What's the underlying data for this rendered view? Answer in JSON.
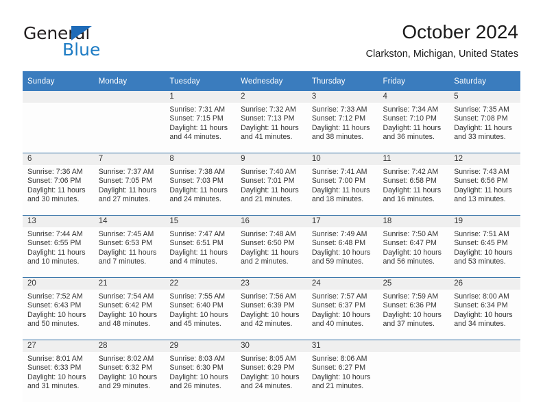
{
  "brand": {
    "name_primary": "General",
    "name_secondary": "Blue",
    "accent_color": "#1e7cc4",
    "triangle_color": "#1e6bb8"
  },
  "header": {
    "title": "October 2024",
    "subtitle": "Clarkston, Michigan, United States"
  },
  "theme": {
    "header_band": "#3a7cbe",
    "daynum_band": "#efefef",
    "week_divider": "#2e6da4",
    "text": "#333333"
  },
  "calendar": {
    "weekday_headers": [
      "Sunday",
      "Monday",
      "Tuesday",
      "Wednesday",
      "Thursday",
      "Friday",
      "Saturday"
    ],
    "labels": {
      "sunrise_prefix": "Sunrise:",
      "sunset_prefix": "Sunset:",
      "daylight_prefix": "Daylight:"
    },
    "weeks": [
      [
        {
          "day": "",
          "sunrise": "",
          "sunset": "",
          "daylight": "",
          "empty": true
        },
        {
          "day": "",
          "sunrise": "",
          "sunset": "",
          "daylight": "",
          "empty": true
        },
        {
          "day": "1",
          "sunrise": "Sunrise: 7:31 AM",
          "sunset": "Sunset: 7:15 PM",
          "daylight": "Daylight: 11 hours and 44 minutes.",
          "empty": false
        },
        {
          "day": "2",
          "sunrise": "Sunrise: 7:32 AM",
          "sunset": "Sunset: 7:13 PM",
          "daylight": "Daylight: 11 hours and 41 minutes.",
          "empty": false
        },
        {
          "day": "3",
          "sunrise": "Sunrise: 7:33 AM",
          "sunset": "Sunset: 7:12 PM",
          "daylight": "Daylight: 11 hours and 38 minutes.",
          "empty": false
        },
        {
          "day": "4",
          "sunrise": "Sunrise: 7:34 AM",
          "sunset": "Sunset: 7:10 PM",
          "daylight": "Daylight: 11 hours and 36 minutes.",
          "empty": false
        },
        {
          "day": "5",
          "sunrise": "Sunrise: 7:35 AM",
          "sunset": "Sunset: 7:08 PM",
          "daylight": "Daylight: 11 hours and 33 minutes.",
          "empty": false
        }
      ],
      [
        {
          "day": "6",
          "sunrise": "Sunrise: 7:36 AM",
          "sunset": "Sunset: 7:06 PM",
          "daylight": "Daylight: 11 hours and 30 minutes.",
          "empty": false
        },
        {
          "day": "7",
          "sunrise": "Sunrise: 7:37 AM",
          "sunset": "Sunset: 7:05 PM",
          "daylight": "Daylight: 11 hours and 27 minutes.",
          "empty": false
        },
        {
          "day": "8",
          "sunrise": "Sunrise: 7:38 AM",
          "sunset": "Sunset: 7:03 PM",
          "daylight": "Daylight: 11 hours and 24 minutes.",
          "empty": false
        },
        {
          "day": "9",
          "sunrise": "Sunrise: 7:40 AM",
          "sunset": "Sunset: 7:01 PM",
          "daylight": "Daylight: 11 hours and 21 minutes.",
          "empty": false
        },
        {
          "day": "10",
          "sunrise": "Sunrise: 7:41 AM",
          "sunset": "Sunset: 7:00 PM",
          "daylight": "Daylight: 11 hours and 18 minutes.",
          "empty": false
        },
        {
          "day": "11",
          "sunrise": "Sunrise: 7:42 AM",
          "sunset": "Sunset: 6:58 PM",
          "daylight": "Daylight: 11 hours and 16 minutes.",
          "empty": false
        },
        {
          "day": "12",
          "sunrise": "Sunrise: 7:43 AM",
          "sunset": "Sunset: 6:56 PM",
          "daylight": "Daylight: 11 hours and 13 minutes.",
          "empty": false
        }
      ],
      [
        {
          "day": "13",
          "sunrise": "Sunrise: 7:44 AM",
          "sunset": "Sunset: 6:55 PM",
          "daylight": "Daylight: 11 hours and 10 minutes.",
          "empty": false
        },
        {
          "day": "14",
          "sunrise": "Sunrise: 7:45 AM",
          "sunset": "Sunset: 6:53 PM",
          "daylight": "Daylight: 11 hours and 7 minutes.",
          "empty": false
        },
        {
          "day": "15",
          "sunrise": "Sunrise: 7:47 AM",
          "sunset": "Sunset: 6:51 PM",
          "daylight": "Daylight: 11 hours and 4 minutes.",
          "empty": false
        },
        {
          "day": "16",
          "sunrise": "Sunrise: 7:48 AM",
          "sunset": "Sunset: 6:50 PM",
          "daylight": "Daylight: 11 hours and 2 minutes.",
          "empty": false
        },
        {
          "day": "17",
          "sunrise": "Sunrise: 7:49 AM",
          "sunset": "Sunset: 6:48 PM",
          "daylight": "Daylight: 10 hours and 59 minutes.",
          "empty": false
        },
        {
          "day": "18",
          "sunrise": "Sunrise: 7:50 AM",
          "sunset": "Sunset: 6:47 PM",
          "daylight": "Daylight: 10 hours and 56 minutes.",
          "empty": false
        },
        {
          "day": "19",
          "sunrise": "Sunrise: 7:51 AM",
          "sunset": "Sunset: 6:45 PM",
          "daylight": "Daylight: 10 hours and 53 minutes.",
          "empty": false
        }
      ],
      [
        {
          "day": "20",
          "sunrise": "Sunrise: 7:52 AM",
          "sunset": "Sunset: 6:43 PM",
          "daylight": "Daylight: 10 hours and 50 minutes.",
          "empty": false
        },
        {
          "day": "21",
          "sunrise": "Sunrise: 7:54 AM",
          "sunset": "Sunset: 6:42 PM",
          "daylight": "Daylight: 10 hours and 48 minutes.",
          "empty": false
        },
        {
          "day": "22",
          "sunrise": "Sunrise: 7:55 AM",
          "sunset": "Sunset: 6:40 PM",
          "daylight": "Daylight: 10 hours and 45 minutes.",
          "empty": false
        },
        {
          "day": "23",
          "sunrise": "Sunrise: 7:56 AM",
          "sunset": "Sunset: 6:39 PM",
          "daylight": "Daylight: 10 hours and 42 minutes.",
          "empty": false
        },
        {
          "day": "24",
          "sunrise": "Sunrise: 7:57 AM",
          "sunset": "Sunset: 6:37 PM",
          "daylight": "Daylight: 10 hours and 40 minutes.",
          "empty": false
        },
        {
          "day": "25",
          "sunrise": "Sunrise: 7:59 AM",
          "sunset": "Sunset: 6:36 PM",
          "daylight": "Daylight: 10 hours and 37 minutes.",
          "empty": false
        },
        {
          "day": "26",
          "sunrise": "Sunrise: 8:00 AM",
          "sunset": "Sunset: 6:34 PM",
          "daylight": "Daylight: 10 hours and 34 minutes.",
          "empty": false
        }
      ],
      [
        {
          "day": "27",
          "sunrise": "Sunrise: 8:01 AM",
          "sunset": "Sunset: 6:33 PM",
          "daylight": "Daylight: 10 hours and 31 minutes.",
          "empty": false
        },
        {
          "day": "28",
          "sunrise": "Sunrise: 8:02 AM",
          "sunset": "Sunset: 6:32 PM",
          "daylight": "Daylight: 10 hours and 29 minutes.",
          "empty": false
        },
        {
          "day": "29",
          "sunrise": "Sunrise: 8:03 AM",
          "sunset": "Sunset: 6:30 PM",
          "daylight": "Daylight: 10 hours and 26 minutes.",
          "empty": false
        },
        {
          "day": "30",
          "sunrise": "Sunrise: 8:05 AM",
          "sunset": "Sunset: 6:29 PM",
          "daylight": "Daylight: 10 hours and 24 minutes.",
          "empty": false
        },
        {
          "day": "31",
          "sunrise": "Sunrise: 8:06 AM",
          "sunset": "Sunset: 6:27 PM",
          "daylight": "Daylight: 10 hours and 21 minutes.",
          "empty": false
        },
        {
          "day": "",
          "sunrise": "",
          "sunset": "",
          "daylight": "",
          "empty": true
        },
        {
          "day": "",
          "sunrise": "",
          "sunset": "",
          "daylight": "",
          "empty": true
        }
      ]
    ]
  }
}
